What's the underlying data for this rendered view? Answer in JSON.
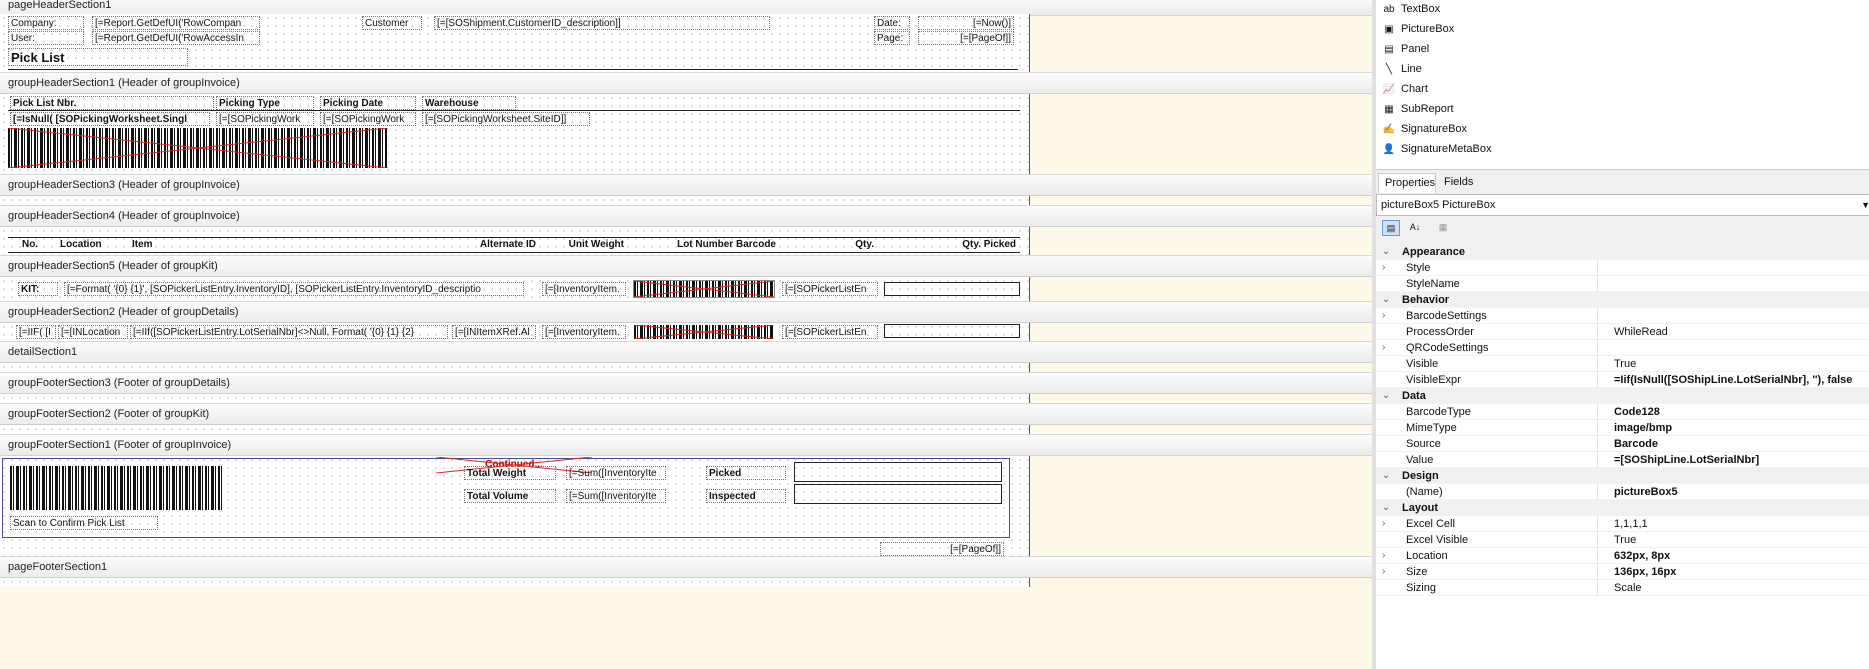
{
  "sections": {
    "page_header": "pageHeaderSection1",
    "group_header_1": "groupHeaderSection1 (Header of groupInvoice)",
    "group_header_3": "groupHeaderSection3 (Header of groupInvoice)",
    "group_header_4": "groupHeaderSection4 (Header of groupInvoice)",
    "group_header_5": "groupHeaderSection5 (Header of groupKit)",
    "group_header_2": "groupHeaderSection2 (Header of groupDetails)",
    "detail": "detailSection1",
    "group_footer_3": "groupFooterSection3 (Footer of groupDetails)",
    "group_footer_2": "groupFooterSection2 (Footer of groupKit)",
    "group_footer_1": "groupFooterSection1 (Footer of groupInvoice)",
    "page_footer": "pageFooterSection1"
  },
  "page_header": {
    "company_label": "Company:",
    "company_value": "[=Report.GetDefUI('RowCompan",
    "user_label": "User:",
    "user_value": "[=Report.GetDefUI('RowAccessIn",
    "customer_label": "Customer",
    "customer_value": "[=[SOShipment.CustomerID_description]]",
    "date_label": "Date:",
    "date_value": "[=Now()]",
    "page_label": "Page:",
    "page_value": "[=[PageOf]]",
    "title": "Pick List"
  },
  "group_header_1": {
    "pick_list_nbr_label": "Pick List Nbr.",
    "picking_type_label": "Picking Type",
    "picking_date_label": "Picking Date",
    "warehouse_label": "Warehouse",
    "isnull_value": "[=IsNull( [SOPickingWorksheet.Singl",
    "picking_type_value": "[=[SOPickingWork",
    "picking_date_value": "[=[SOPickingWork",
    "site_value": "[=[SOPickingWorksheet.SiteID]]"
  },
  "group_header_4": {
    "col_no": "No.",
    "col_location": "Location",
    "col_item": "Item",
    "col_alternate_id": "Alternate ID",
    "col_unit_weight": "Unit Weight",
    "col_lot_barcode": "Lot Number Barcode",
    "col_qty": "Qty.",
    "col_qty_picked": "Qty. Picked"
  },
  "group_header_5": {
    "kit_label": "KIT:",
    "kit_format": "[=Format( '{0} {1}', [SOPickerListEntry.InventoryID], [SOPickerListEntry.InventoryID_descriptio",
    "inventory_item": "[=[InventoryItem.",
    "picker_list": "[=[SOPickerListEn"
  },
  "group_header_2": {
    "iif_value": "[=IIF( [I",
    "inlocation_value": "[=[INLocation",
    "lot_serial_value": "[=IIf([SOPickerListEntry.LotSerialNbr]<>Null, Format( '{0} {1} {2}",
    "initemxref_value": "[=[INItemXRef.Al",
    "inventory_item": "[=[InventoryItem.",
    "picker_list": "[=[SOPickerListEn"
  },
  "group_footer_1": {
    "continued": "Continued...",
    "total_weight_label": "Total Weight",
    "total_weight_value": "[=Sum([InventoryIte",
    "total_volume_label": "Total Volume",
    "total_volume_value": "[=Sum([InventoryIte",
    "picked_label": "Picked",
    "inspected_label": "Inspected",
    "scan_label": "Scan to Confirm Pick List",
    "page_of": "[=[PageOf]]"
  },
  "toolbox": {
    "items": [
      {
        "label": "TextBox",
        "icon": "textbox-icon",
        "glyph": "ab"
      },
      {
        "label": "PictureBox",
        "icon": "picturebox-icon",
        "glyph": "▣"
      },
      {
        "label": "Panel",
        "icon": "panel-icon",
        "glyph": "▤"
      },
      {
        "label": "Line",
        "icon": "line-icon",
        "glyph": "╲"
      },
      {
        "label": "Chart",
        "icon": "chart-icon",
        "glyph": "📈"
      },
      {
        "label": "SubReport",
        "icon": "subreport-icon",
        "glyph": "▦"
      },
      {
        "label": "SignatureBox",
        "icon": "signature-icon",
        "glyph": "✍"
      },
      {
        "label": "SignatureMetaBox",
        "icon": "person-icon",
        "glyph": "👤"
      }
    ]
  },
  "properties_panel": {
    "tabs": [
      "Properties",
      "Fields"
    ],
    "selected_object": "pictureBox5 PictureBox",
    "rows": [
      {
        "type": "category",
        "name": "Appearance"
      },
      {
        "type": "prop",
        "name": "Style",
        "value": "",
        "expandable": true
      },
      {
        "type": "prop",
        "name": "StyleName",
        "value": ""
      },
      {
        "type": "category",
        "name": "Behavior"
      },
      {
        "type": "prop",
        "name": "BarcodeSettings",
        "value": "",
        "expandable": true
      },
      {
        "type": "prop",
        "name": "ProcessOrder",
        "value": "WhileRead"
      },
      {
        "type": "prop",
        "name": "QRCodeSettings",
        "value": "",
        "expandable": true
      },
      {
        "type": "prop",
        "name": "Visible",
        "value": "True"
      },
      {
        "type": "prop",
        "name": "VisibleExpr",
        "value": "=Iif(IsNull([SOShipLine.LotSerialNbr], ''), false",
        "bold": true
      },
      {
        "type": "category",
        "name": "Data"
      },
      {
        "type": "prop",
        "name": "BarcodeType",
        "value": "Code128",
        "bold": true
      },
      {
        "type": "prop",
        "name": "MimeType",
        "value": "image/bmp",
        "bold": true
      },
      {
        "type": "prop",
        "name": "Source",
        "value": "Barcode",
        "bold": true
      },
      {
        "type": "prop",
        "name": "Value",
        "value": "=[SOShipLine.LotSerialNbr]",
        "bold": true
      },
      {
        "type": "category",
        "name": "Design"
      },
      {
        "type": "prop",
        "name": "(Name)",
        "value": "pictureBox5",
        "bold": true
      },
      {
        "type": "category",
        "name": "Layout"
      },
      {
        "type": "prop",
        "name": "Excel Cell",
        "value": "1,1,1,1",
        "expandable": true
      },
      {
        "type": "prop",
        "name": "Excel Visible",
        "value": "True"
      },
      {
        "type": "prop",
        "name": "Location",
        "value": "632px, 8px",
        "bold": true,
        "expandable": true
      },
      {
        "type": "prop",
        "name": "Size",
        "value": "136px, 16px",
        "bold": true,
        "expandable": true
      },
      {
        "type": "prop",
        "name": "Sizing",
        "value": "Scale"
      }
    ]
  }
}
